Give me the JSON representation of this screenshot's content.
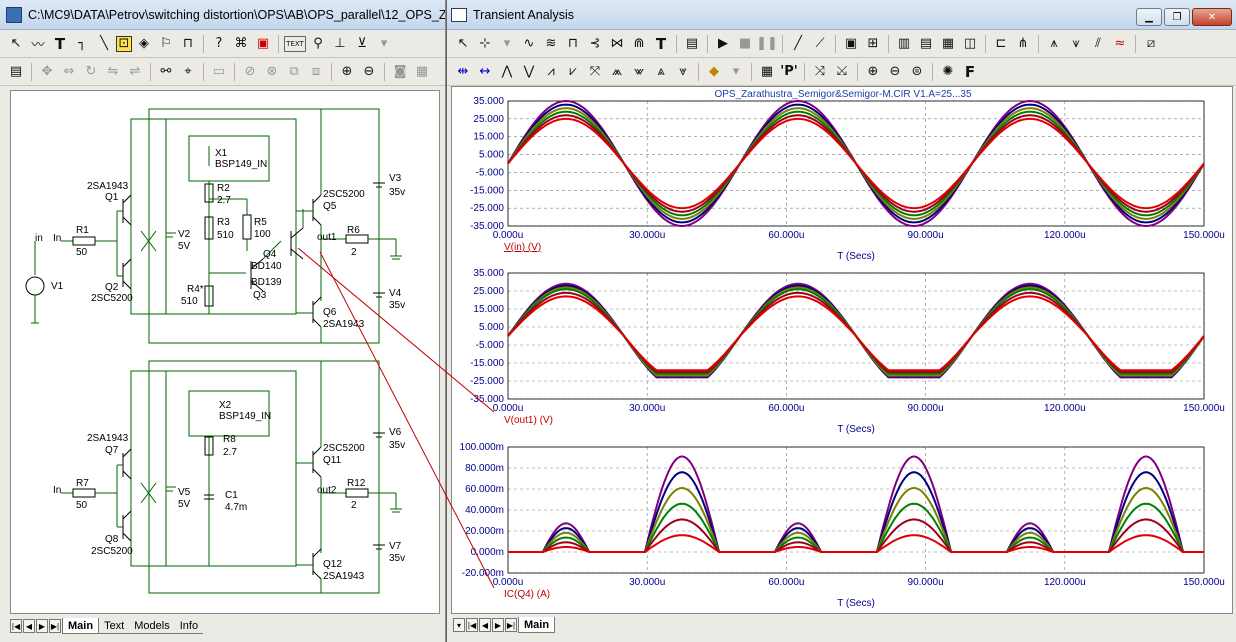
{
  "left_window": {
    "title": "C:\\MC9\\DATA\\Petrov\\switching distortion\\OPS\\AB\\OPS_parallel\\12_OPS_Za",
    "toolbar1": [
      "pointer-icon",
      "wire-icon",
      "text-icon",
      "orthowire-icon",
      "diagwire-icon",
      "info-icon",
      "graphics-icon",
      "flag-icon",
      "pinA-icon",
      "help-icon",
      "calc-icon",
      "probe-icon"
    ],
    "toolbar1_text_btn": "TEXT",
    "tabs": [
      "Main",
      "Text",
      "Models",
      "Info"
    ],
    "active_tab": "Main"
  },
  "schematic": {
    "top": {
      "in_label": "in",
      "In_label": "In",
      "R1": "R1",
      "R1_val": "50",
      "V1": "V1",
      "Q1_type": "2SA1943",
      "Q1": "Q1",
      "Q2": "Q2",
      "Q2_type": "2SC5200",
      "V2": "V2",
      "V2_val": "5V",
      "X1": "X1",
      "X1_type": "BSP149_IN",
      "R2": "R2",
      "R2_val": "2.7",
      "R3": "R3",
      "R3_val": "510",
      "R5": "R5",
      "R5_val": "100",
      "Q4": "Q4",
      "Q4_type": "BD140",
      "Q3_type": "BD139",
      "Q3": "Q3",
      "R4": "R4*",
      "R4_val": "510",
      "Q5_type": "2SC5200",
      "Q5": "Q5",
      "out_label": "out1",
      "R6": "R6",
      "R6_val": "2",
      "V3": "V3",
      "V3_val": "35v",
      "V4": "V4",
      "V4_val": "35v",
      "Q6": "Q6",
      "Q6_type": "2SA1943"
    },
    "bottom": {
      "In_label": "In",
      "R7": "R7",
      "R7_val": "50",
      "Q7_type": "2SA1943",
      "Q7": "Q7",
      "Q8": "Q8",
      "Q8_type": "2SC5200",
      "V5": "V5",
      "V5_val": "5V",
      "X2": "X2",
      "X2_type": "BSP149_IN",
      "R8": "R8",
      "R8_val": "2.7",
      "C1": "C1",
      "C1_val": "4.7m",
      "Q11_type": "2SC5200",
      "Q11": "Q11",
      "out_label": "out2",
      "R12": "R12",
      "R12_val": "2",
      "V6": "V6",
      "V6_val": "35v",
      "V7": "V7",
      "V7_val": "35v",
      "Q12": "Q12",
      "Q12_type": "2SA1943"
    }
  },
  "right_window": {
    "title": "Transient Analysis",
    "tabs": [
      "Main"
    ],
    "plot_title": "OPS_Zarathustra_Semigor&Semigor-M.CIR V1.A=25...35",
    "x_label": "T (Secs)",
    "x_ticks": [
      "0.000u",
      "30.000u",
      "60.000u",
      "90.000u",
      "120.000u",
      "150.000u"
    ]
  },
  "chart_data": [
    {
      "type": "line",
      "title": "OPS_Zarathustra_Semigor&Semigor-M.CIR V1.A=25...35",
      "ylabel": "V(in) (V)",
      "xlabel": "T (Secs)",
      "xlim": [
        0,
        150
      ],
      "ylim": [
        -35,
        35
      ],
      "y_ticks": [
        "35.000",
        "25.000",
        "15.000",
        "5.000",
        "-5.000",
        "-15.000",
        "-25.000",
        "-35.000"
      ],
      "waveform": "sine",
      "period_us": 50,
      "series": [
        {
          "amplitude": 25,
          "color": "#e00000"
        },
        {
          "amplitude": 27,
          "color": "#a00020"
        },
        {
          "amplitude": 29,
          "color": "#008000"
        },
        {
          "amplitude": 31,
          "color": "#808000"
        },
        {
          "amplitude": 33,
          "color": "#000080"
        },
        {
          "amplitude": 35,
          "color": "#800080"
        }
      ]
    },
    {
      "type": "line",
      "ylabel": "V(out1) (V)",
      "xlabel": "T (Secs)",
      "xlim": [
        0,
        150
      ],
      "ylim": [
        -35,
        35
      ],
      "y_ticks": [
        "35.000",
        "25.000",
        "15.000",
        "5.000",
        "-5.000",
        "-15.000",
        "-25.000",
        "-35.000"
      ],
      "waveform": "clipped-sine",
      "period_us": 50,
      "series": [
        {
          "pos_peak": 22,
          "neg_peak": -19,
          "color": "#e00000"
        },
        {
          "pos_peak": 24,
          "neg_peak": -20,
          "color": "#a00020"
        },
        {
          "pos_peak": 26,
          "neg_peak": -21,
          "color": "#008000"
        },
        {
          "pos_peak": 27,
          "neg_peak": -22,
          "color": "#808000"
        },
        {
          "pos_peak": 28,
          "neg_peak": -22.5,
          "color": "#000080"
        },
        {
          "pos_peak": 29,
          "neg_peak": -23,
          "color": "#800080"
        }
      ]
    },
    {
      "type": "line",
      "ylabel": "IC(Q4) (A)",
      "xlabel": "T (Secs)",
      "xlim": [
        0,
        150
      ],
      "ylim": [
        -0.02,
        0.1
      ],
      "y_ticks": [
        "100.000m",
        "80.000m",
        "60.000m",
        "40.000m",
        "20.000m",
        "0.000m",
        "-20.000m"
      ],
      "waveform": "pulses",
      "pulses": [
        {
          "center": 12.5,
          "half_width": 5,
          "scale": 0.3
        },
        {
          "center": 37.5,
          "half_width": 8,
          "scale": 1.0
        },
        {
          "center": 62.5,
          "half_width": 5,
          "scale": 0.3
        },
        {
          "center": 87.5,
          "half_width": 8,
          "scale": 1.0
        },
        {
          "center": 112.5,
          "half_width": 5,
          "scale": 0.3
        },
        {
          "center": 137.5,
          "half_width": 8,
          "scale": 1.0
        }
      ],
      "series": [
        {
          "peak": 0.016,
          "color": "#e00000"
        },
        {
          "peak": 0.031,
          "color": "#a00020"
        },
        {
          "peak": 0.046,
          "color": "#008000"
        },
        {
          "peak": 0.061,
          "color": "#808000"
        },
        {
          "peak": 0.076,
          "color": "#000080"
        },
        {
          "peak": 0.091,
          "color": "#800080"
        }
      ]
    }
  ]
}
